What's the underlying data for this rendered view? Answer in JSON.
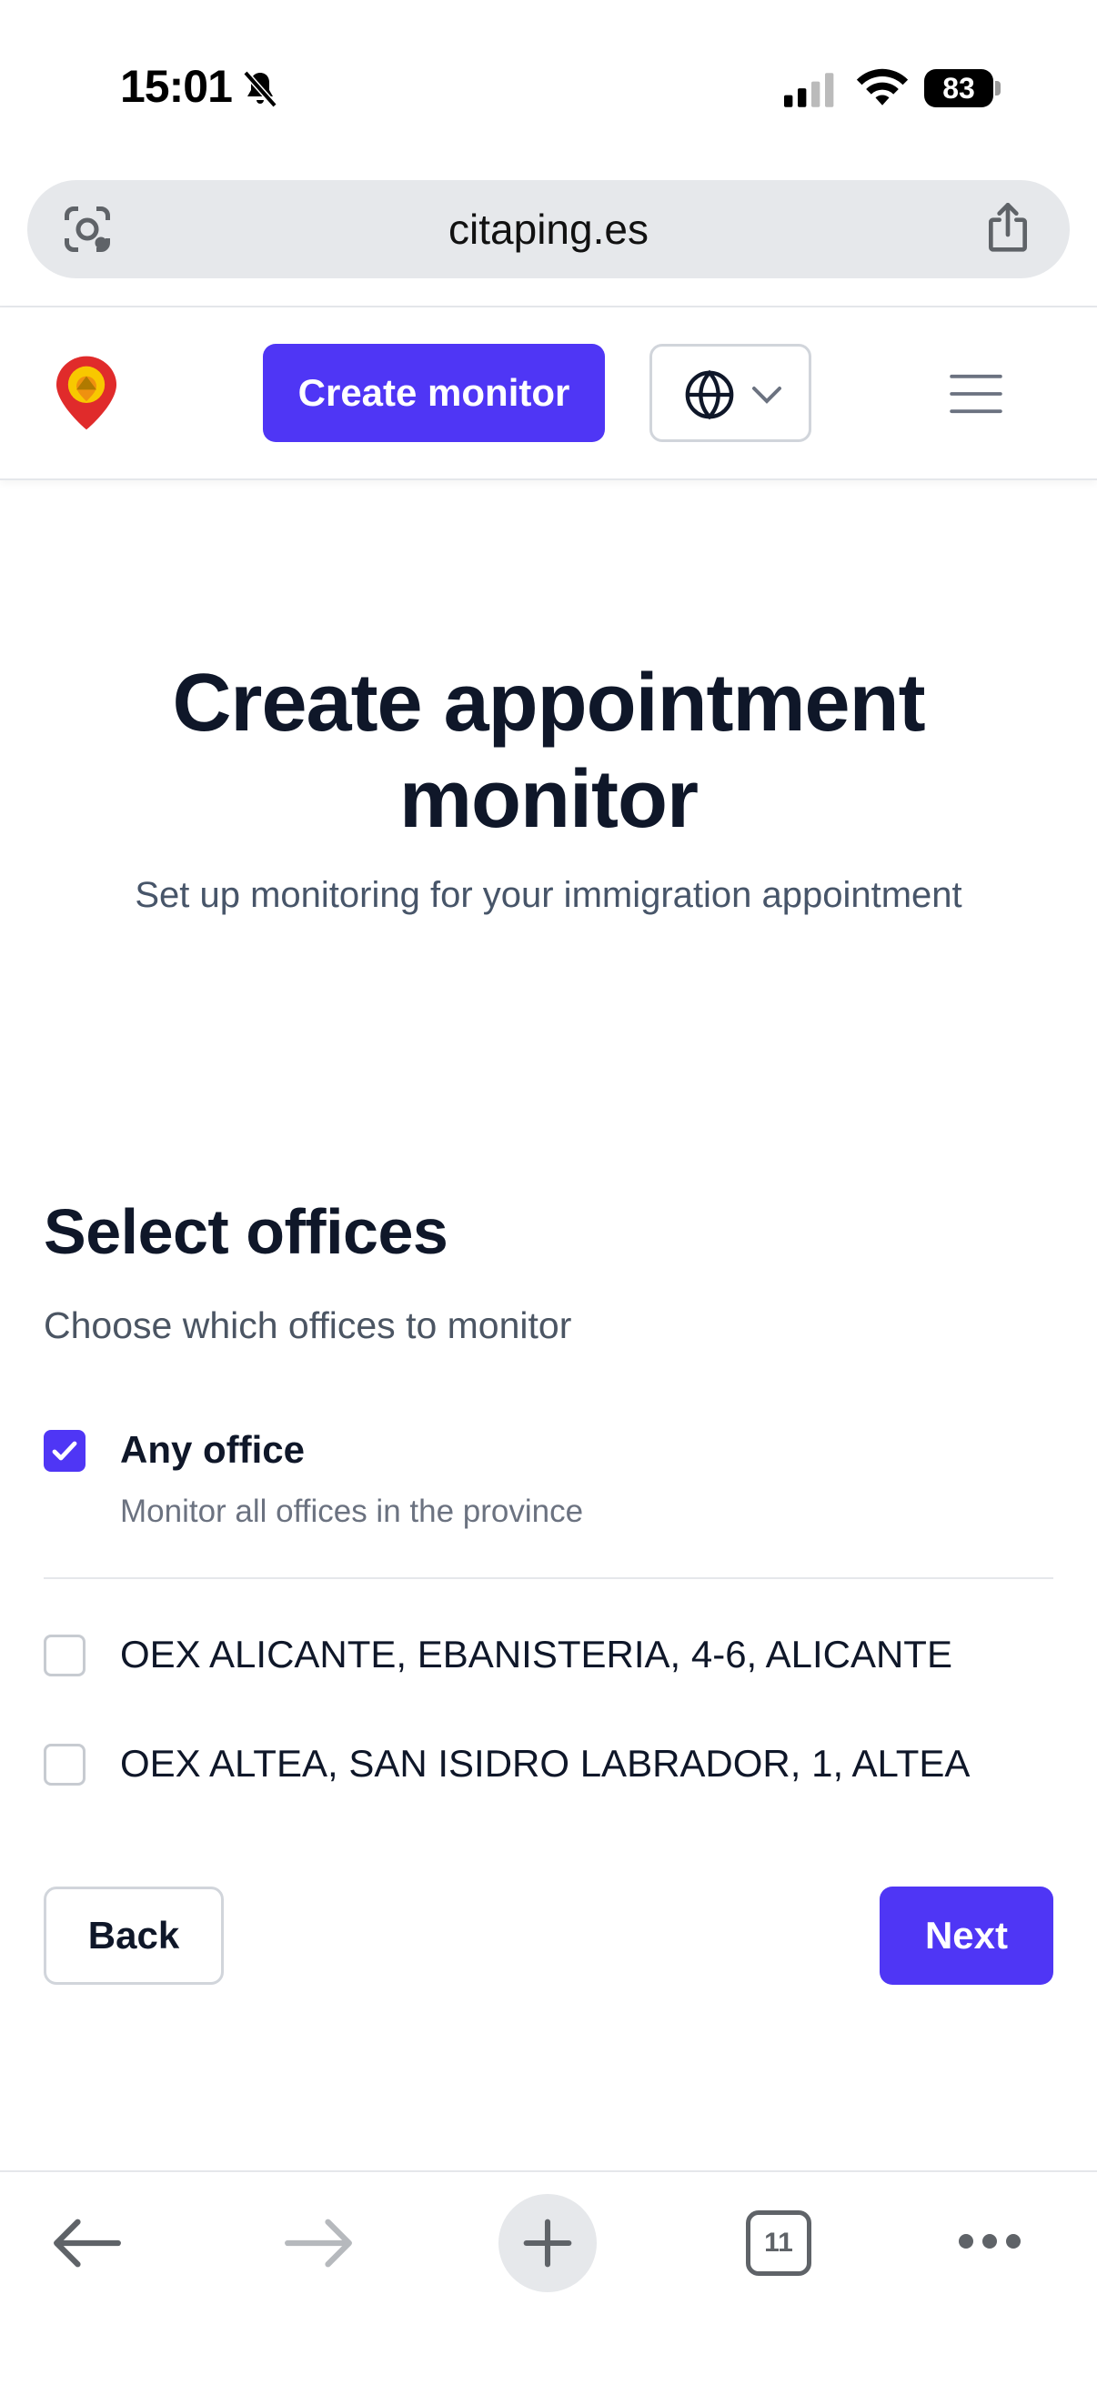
{
  "status_bar": {
    "time": "15:01",
    "battery": "83",
    "icons": [
      "bell-slash-icon",
      "signal-icon",
      "wifi-icon",
      "battery-icon"
    ]
  },
  "browser": {
    "url": "citaping.es",
    "icons": [
      "lens-icon",
      "share-icon"
    ]
  },
  "header": {
    "create_monitor_label": "Create monitor",
    "icons": [
      "logo-pin-icon",
      "globe-icon",
      "chevron-down-icon",
      "menu-icon"
    ]
  },
  "hero": {
    "title": "Create appointment monitor",
    "subtitle": "Set up monitoring for your immigration appointment"
  },
  "section": {
    "title": "Select offices",
    "subtitle": "Choose which offices to monitor"
  },
  "options": [
    {
      "label": "Any office",
      "description": "Monitor all offices in the province",
      "checked": true
    },
    {
      "label": "OEX ALICANTE, EBANISTERIA, 4-6, ALICANTE",
      "checked": false
    },
    {
      "label": "OEX ALTEA, SAN ISIDRO LABRADOR, 1, ALTEA",
      "checked": false
    }
  ],
  "actions": {
    "back_label": "Back",
    "next_label": "Next"
  },
  "toolbar": {
    "tab_count": "11",
    "icons": [
      "back-arrow-icon",
      "forward-arrow-icon",
      "plus-icon",
      "tabs-icon",
      "more-icon"
    ]
  },
  "colors": {
    "accent": "#4f36f5",
    "text_primary": "#0f1729",
    "text_secondary": "#475569"
  }
}
